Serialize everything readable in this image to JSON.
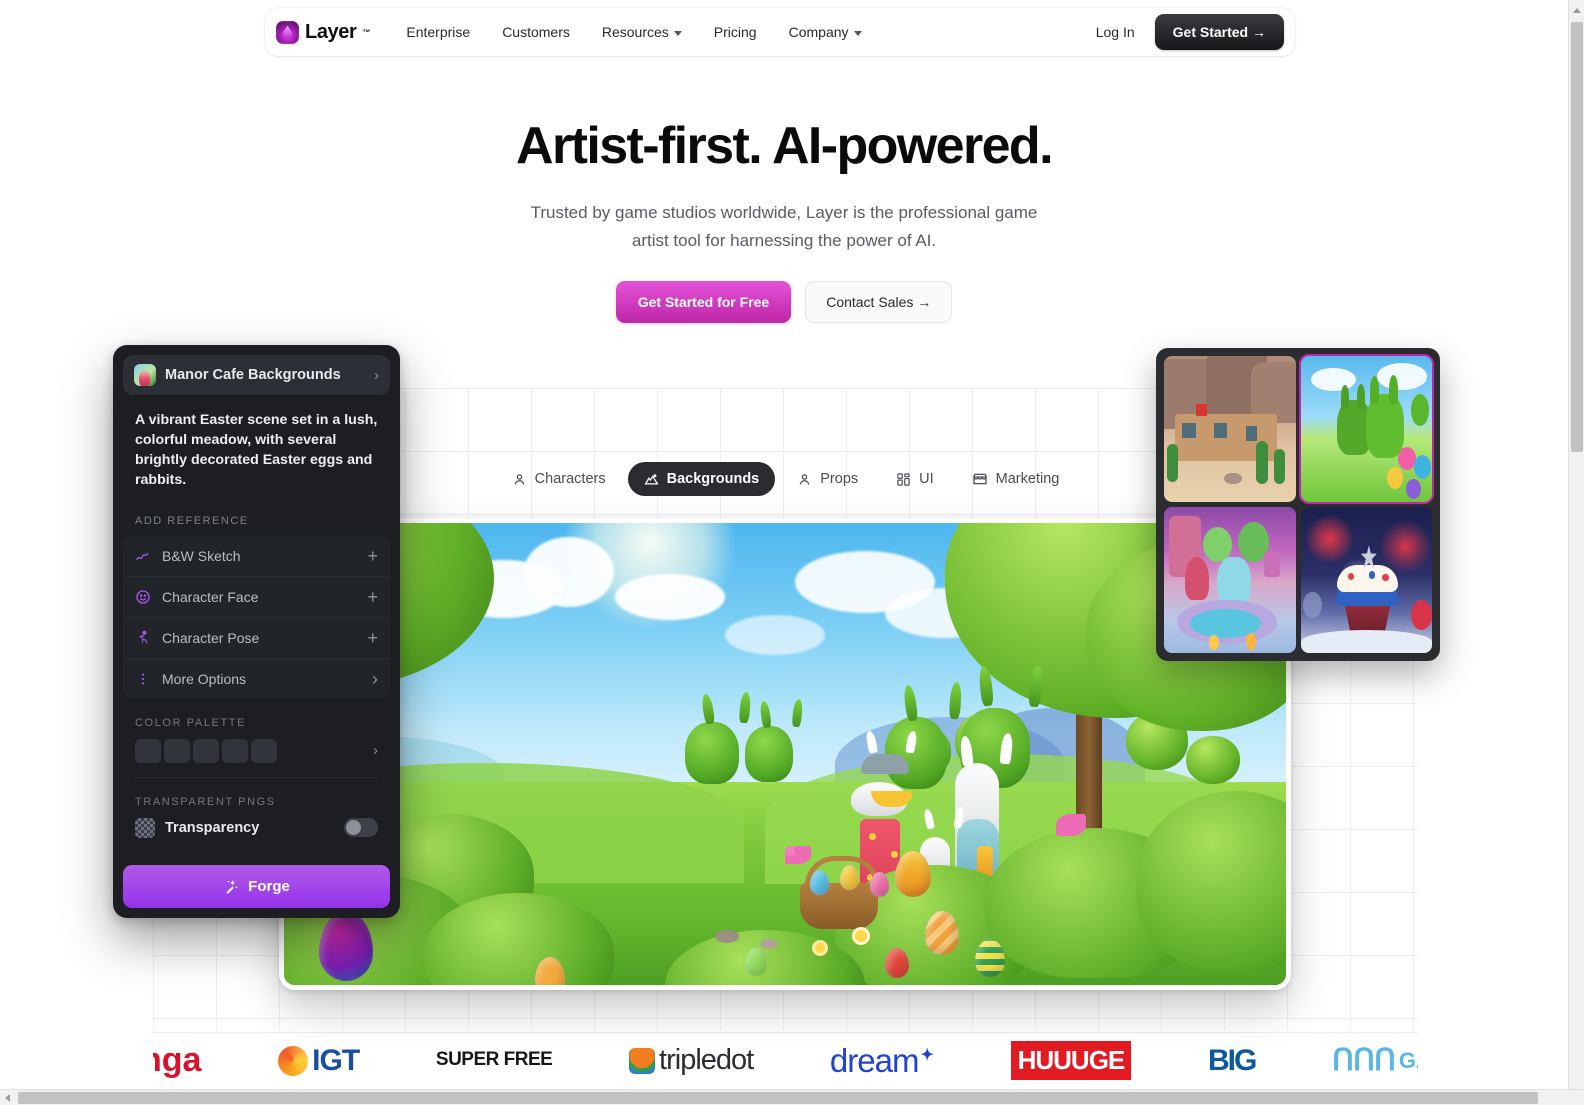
{
  "nav": {
    "brand": {
      "name": "Layer",
      "tm": "™",
      "icon": "layer-droplet-logo"
    },
    "links": [
      {
        "label": "Enterprise",
        "has_dropdown": false
      },
      {
        "label": "Customers",
        "has_dropdown": false
      },
      {
        "label": "Resources",
        "has_dropdown": true
      },
      {
        "label": "Pricing",
        "has_dropdown": false
      },
      {
        "label": "Company",
        "has_dropdown": true
      }
    ],
    "login_label": "Log In",
    "cta_label": "Get Started →"
  },
  "hero": {
    "headline": "Artist-first. AI-powered.",
    "subhead": "Trusted by game studios worldwide, Layer is the professional game artist tool for harnessing the power of AI.",
    "primary_cta": "Get Started for Free",
    "secondary_cta": "Contact Sales →"
  },
  "app": {
    "tabs": [
      {
        "label": "Characters",
        "icon": "person-icon",
        "active": false
      },
      {
        "label": "Backgrounds",
        "icon": "mountain-icon",
        "active": true
      },
      {
        "label": "Props",
        "icon": "person-icon",
        "active": false
      },
      {
        "label": "UI",
        "icon": "grid-layout-icon",
        "active": false
      },
      {
        "label": "Marketing",
        "icon": "storefront-icon",
        "active": false
      }
    ],
    "canvas_alt": "Easter meadow scene with girl, topiary bunnies, rabbit statues and decorated eggs"
  },
  "panel": {
    "project_title": "Manor Cafe Backgrounds",
    "project_chevron": "›",
    "prompt": "A vibrant Easter scene set in a lush, colorful meadow, with several brightly decorated Easter eggs and rabbits.",
    "add_reference_label": "ADD REFERENCE",
    "references": [
      {
        "label": "B&W Sketch",
        "icon": "scribble-icon",
        "action": "+"
      },
      {
        "label": "Character Face",
        "icon": "smiley-face-icon",
        "action": "+"
      },
      {
        "label": "Character Pose",
        "icon": "running-person-icon",
        "action": "+"
      },
      {
        "label": "More Options",
        "icon": "vertical-dots-icon",
        "action": "›"
      }
    ],
    "color_palette_label": "COLOR PALETTE",
    "swatch_count": 5,
    "palette_chevron": "›",
    "transparent_label": "TRANSPARENT PNGS",
    "transparency_label": "Transparency",
    "transparency_on": false,
    "forge_label": "Forge",
    "forge_icon": "magic-wand-icon"
  },
  "thumbnails": [
    {
      "name": "desert-pueblo-background",
      "selected": false
    },
    {
      "name": "topiary-bunnies-meadow-background",
      "selected": true
    },
    {
      "name": "fantasy-garden-fountain-background",
      "selected": false
    },
    {
      "name": "patriotic-cupcake-fireworks-background",
      "selected": false
    }
  ],
  "partners": [
    {
      "label": "nga",
      "color": "#d6122c"
    },
    {
      "label": "IGT",
      "color": "#1a4fa0"
    },
    {
      "label": "SUPER FREE",
      "color": "#1c1c1c"
    },
    {
      "label": "tripledot",
      "color": "#2c2c34"
    },
    {
      "label": "dream",
      "color": "#2244cc"
    },
    {
      "label": "HUUUGE",
      "color": "#ffffff"
    },
    {
      "label": "BIG",
      "color": "#0b5a9e"
    },
    {
      "label": "GA",
      "color": "#5bb6e8"
    }
  ],
  "colors": {
    "brand_purple": "#a855f7",
    "accent_pink": "#c026a8",
    "panel_bg": "#1c1e22",
    "dark_button": "#18181b"
  }
}
